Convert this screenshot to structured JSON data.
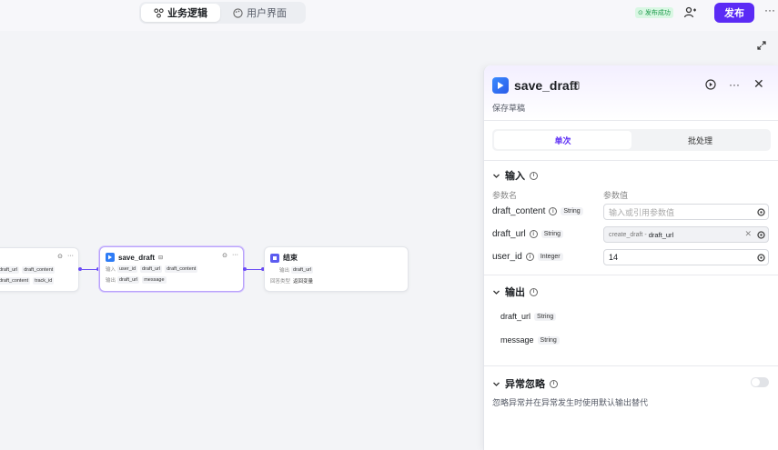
{
  "header": {
    "tabs": [
      {
        "label": "业务逻辑",
        "icon": "workflow-icon",
        "active": true
      },
      {
        "label": "用户界面",
        "icon": "palette-icon",
        "active": false
      }
    ],
    "status_badge": "发布成功",
    "publish_label": "发布",
    "more_label": "···"
  },
  "canvas": {
    "nodes": [
      {
        "id": "prev",
        "rows": [
          {
            "chips": [
              "draft_url",
              "draft_content"
            ]
          },
          {
            "chips": [
              "draft_content",
              "track_id"
            ]
          }
        ]
      },
      {
        "id": "save_draft",
        "title": "save_draft",
        "input_label": "输入",
        "output_label": "输出",
        "inputs": [
          "user_id",
          "draft_url",
          "draft_content"
        ],
        "outputs": [
          "draft_url",
          "message"
        ]
      },
      {
        "id": "end",
        "title": "结束",
        "output_label": "输出",
        "outputs": [
          "draft_url"
        ],
        "answer_mode_label": "回答类型",
        "answer_mode_value": "返回变量"
      }
    ]
  },
  "panel": {
    "title": "save_draft",
    "description": "保存草稿",
    "modes": [
      {
        "label": "单次",
        "active": true
      },
      {
        "label": "批处理",
        "active": false
      }
    ],
    "input_section": {
      "title": "输入",
      "col_name": "参数名",
      "col_value": "参数值",
      "params": [
        {
          "name": "draft_content",
          "type": "String",
          "placeholder": "输入或引用参数值",
          "value": ""
        },
        {
          "name": "draft_url",
          "type": "String",
          "ref_source": "create_draft",
          "ref_arrow": "-",
          "ref_field": "draft_url"
        },
        {
          "name": "user_id",
          "type": "Integer",
          "value": "14"
        }
      ]
    },
    "output_section": {
      "title": "输出",
      "items": [
        {
          "name": "draft_url",
          "type": "String"
        },
        {
          "name": "message",
          "type": "String"
        }
      ]
    },
    "exception_section": {
      "title": "异常忽略",
      "enabled": false,
      "hint": "忽略异常并在异常发生时使用默认输出替代"
    }
  },
  "colors": {
    "accent": "#5b2bf5",
    "edge": "#6a4cf5",
    "success_bg": "#d9f7e3",
    "success_text": "#1d9a4b"
  }
}
